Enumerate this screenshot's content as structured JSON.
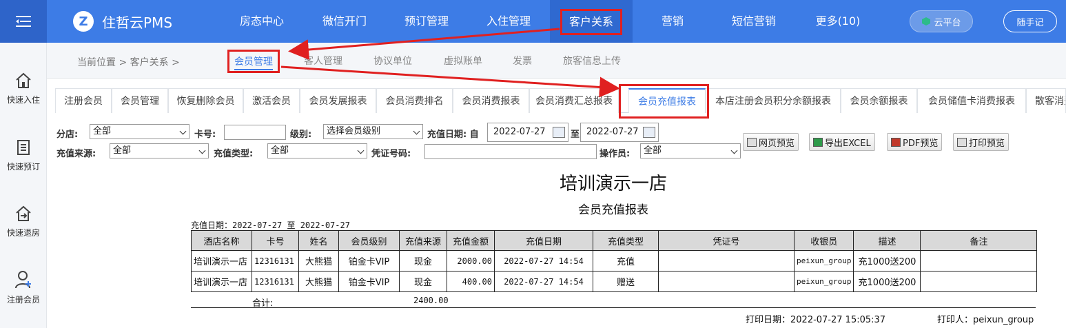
{
  "app": {
    "name": "住哲云PMS",
    "logo_letter": "Z"
  },
  "topnav": [
    {
      "label": "房态中心"
    },
    {
      "label": "微信开门"
    },
    {
      "label": "预订管理"
    },
    {
      "label": "入住管理"
    },
    {
      "label": "客户关系"
    },
    {
      "label": "营销"
    },
    {
      "label": "短信营销"
    },
    {
      "label": "更多(10)"
    }
  ],
  "cloud_label": "云平台",
  "note_label": "随手记",
  "sidebar": [
    {
      "label": "快速入住",
      "icon": "home-icon"
    },
    {
      "label": "快速预订",
      "icon": "document-icon"
    },
    {
      "label": "快速退房",
      "icon": "checkout-icon"
    },
    {
      "label": "注册会员",
      "icon": "add-user-icon"
    }
  ],
  "breadcrumb": "当前位置 > 客户关系 >",
  "subnav": [
    {
      "label": "会员管理"
    },
    {
      "label": "客人管理"
    },
    {
      "label": "协议单位"
    },
    {
      "label": "虚拟账单"
    },
    {
      "label": "发票"
    },
    {
      "label": "旅客信息上传"
    }
  ],
  "tabs": [
    {
      "label": "注册会员"
    },
    {
      "label": "会员管理"
    },
    {
      "label": "恢复删除会员"
    },
    {
      "label": "激活会员"
    },
    {
      "label": "会员发展报表"
    },
    {
      "label": "会员消费排名"
    },
    {
      "label": "会员消费报表"
    },
    {
      "label": "会员消费汇总报表"
    },
    {
      "label": "会员充值报表"
    },
    {
      "label": "本店注册会员积分余额报表"
    },
    {
      "label": "会员余额报表"
    },
    {
      "label": "会员储值卡消费报表"
    },
    {
      "label": "散客消费"
    }
  ],
  "filters": {
    "branch_label": "分店:",
    "branch_value": "全部",
    "card_label": "卡号:",
    "card_value": "",
    "level_label": "级别:",
    "level_value": "选择会员级别",
    "date_label": "充值日期: 自",
    "date_from": "2022-07-27",
    "date_to_label": "至",
    "date_to": "2022-07-27",
    "source_label": "充值来源:",
    "source_value": "全部",
    "type_label": "充值类型:",
    "type_value": "全部",
    "voucher_label": "凭证号码:",
    "voucher_value": "",
    "operator_label": "操作员:",
    "operator_value": "全部"
  },
  "toolbar": [
    {
      "label": "网页预览"
    },
    {
      "label": "导出EXCEL"
    },
    {
      "label": "PDF预览"
    },
    {
      "label": "打印预览"
    }
  ],
  "report": {
    "title": "培训演示一店",
    "subtitle": "会员充值报表",
    "range": "充值日期：2022-07-27 至 2022-07-27",
    "columns": [
      "酒店名称",
      "卡号",
      "姓名",
      "会员级别",
      "充值来源",
      "充值金额",
      "充值日期",
      "充值类型",
      "凭证号",
      "收银员",
      "描述",
      "备注"
    ],
    "rows": [
      [
        "培训演示一店",
        "12316131",
        "大熊猫",
        "铂金卡VIP",
        "现金",
        "2000.00",
        "2022-07-27 14:54",
        "充值",
        "",
        "peixun_group",
        "充1000送200",
        ""
      ],
      [
        "培训演示一店",
        "12316131",
        "大熊猫",
        "铂金卡VIP",
        "现金",
        "400.00",
        "2022-07-27 14:54",
        "赠送",
        "",
        "peixun_group",
        "充1000送200",
        ""
      ]
    ],
    "total_label": "合计:",
    "total_value": "2400.00",
    "print_date": "打印日期：2022-07-27 15:05:37",
    "printed_by": "打印人：peixun_group"
  },
  "colors": {
    "primary": "#3d7ce6",
    "highlight": "#e02020"
  }
}
